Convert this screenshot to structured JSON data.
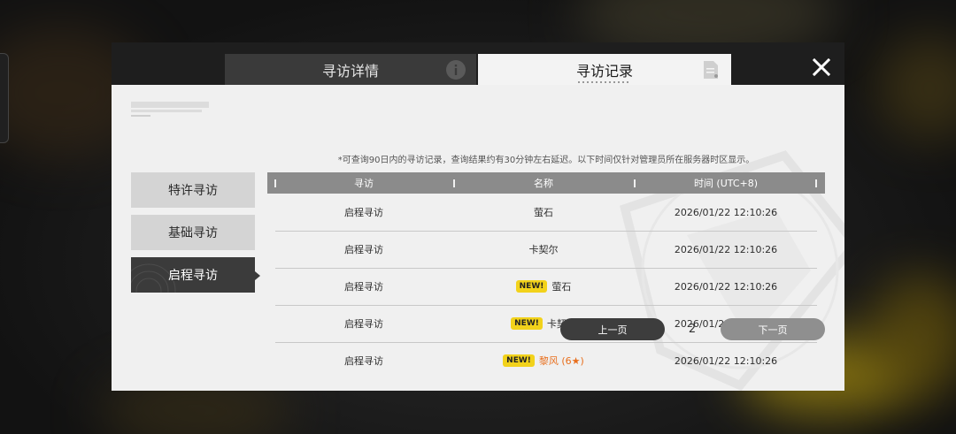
{
  "tabs": {
    "details_label": "寻访详情",
    "records_label": "寻访记录"
  },
  "sidebar": {
    "items": [
      {
        "label": "特许寻访",
        "active": false
      },
      {
        "label": "基础寻访",
        "active": false
      },
      {
        "label": "启程寻访",
        "active": true
      }
    ]
  },
  "notice": "*可查询90日内的寻访记录，查询结果约有30分钟左右延迟。以下时间仅针对管理员所在服务器时区显示。",
  "table": {
    "headers": [
      "寻访",
      "名称",
      "时间 (UTC+8)"
    ],
    "rows": [
      {
        "type": "启程寻访",
        "is_new": false,
        "new_label": "",
        "name": "萤石",
        "highlight": false,
        "time": "2026/01/22 12:10:26"
      },
      {
        "type": "启程寻访",
        "is_new": false,
        "new_label": "",
        "name": "卡契尔",
        "highlight": false,
        "time": "2026/01/22 12:10:26"
      },
      {
        "type": "启程寻访",
        "is_new": true,
        "new_label": "NEW!",
        "name": "萤石",
        "highlight": false,
        "time": "2026/01/22 12:10:26"
      },
      {
        "type": "启程寻访",
        "is_new": true,
        "new_label": "NEW!",
        "name": "卡契尔",
        "highlight": false,
        "time": "2026/01/22 12:10:26"
      },
      {
        "type": "启程寻访",
        "is_new": true,
        "new_label": "NEW!",
        "name": "黎风 (6★)",
        "highlight": true,
        "time": "2026/01/22 12:10:26"
      }
    ]
  },
  "pagination": {
    "prev_label": "上一页",
    "page": "2",
    "next_label": "下一页"
  },
  "colors": {
    "header_bar": "#8b8b8b",
    "new_badge": "#f2d21b",
    "six_star_text": "#e86e1c",
    "active_tab": "#f3f3f3",
    "inactive_tab": "#3a3a3a"
  },
  "icons": {
    "details_tab": "info-icon",
    "records_tab": "document-icon",
    "close": "close-icon"
  }
}
